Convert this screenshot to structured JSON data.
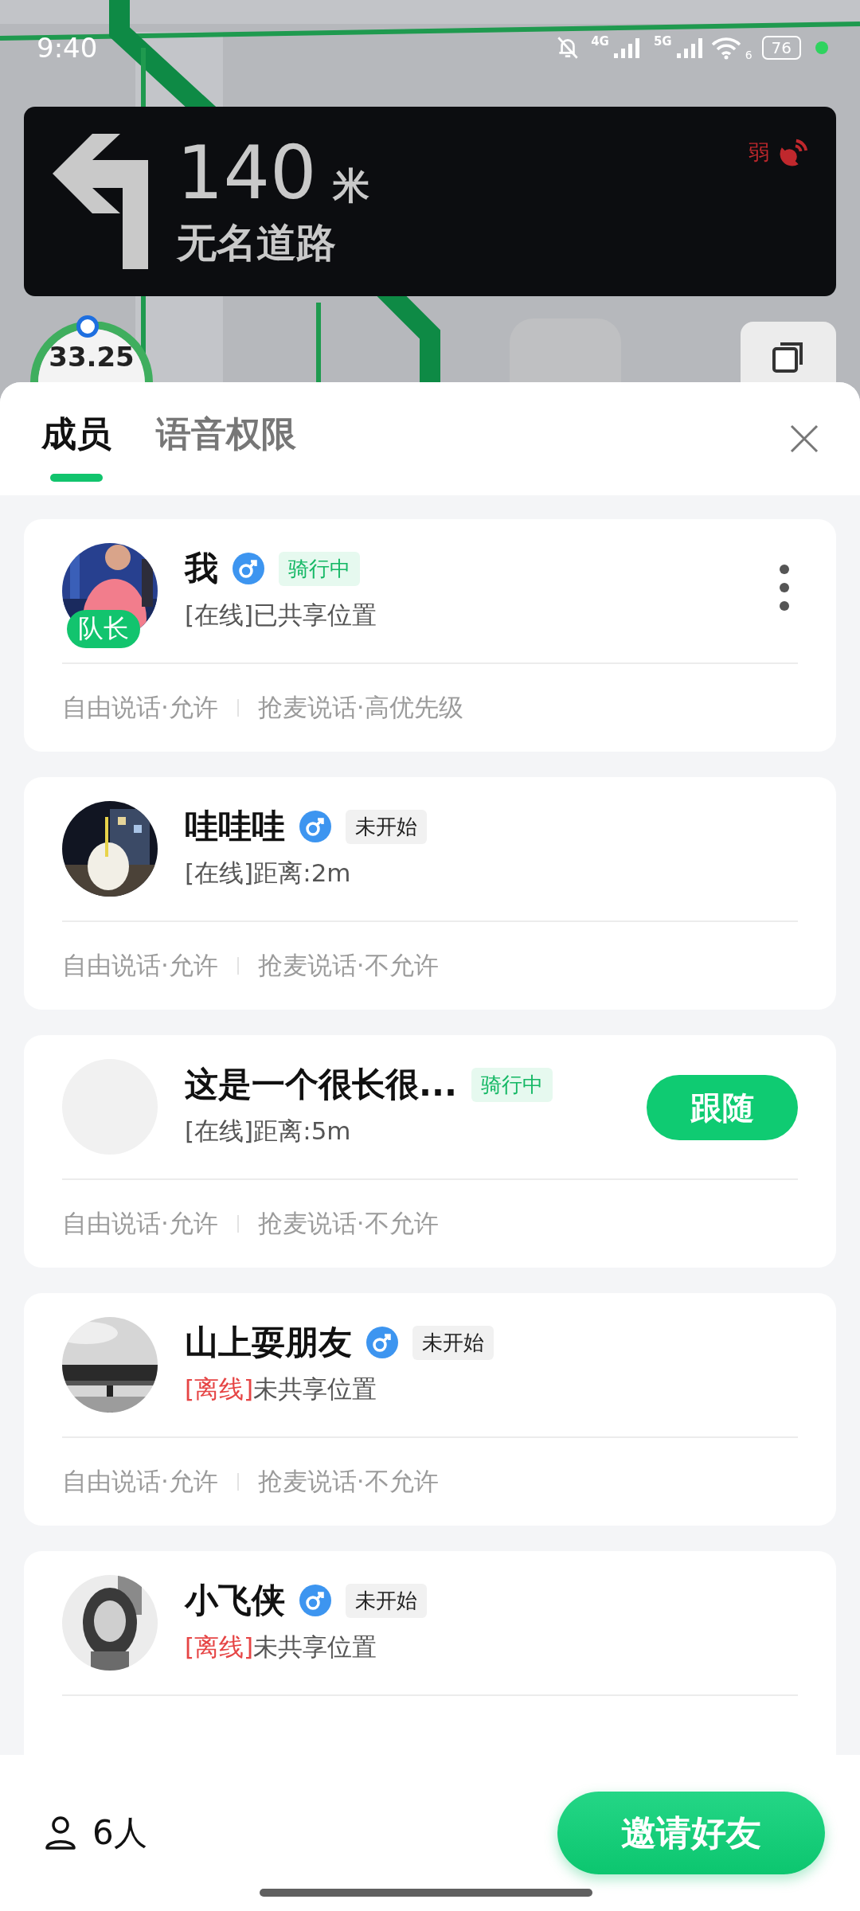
{
  "status_bar": {
    "time": "9:40",
    "sim1": "4G",
    "sim2": "5G",
    "wifi_badge": "6",
    "battery": "76"
  },
  "navigation": {
    "distance": "140",
    "unit": "米",
    "road": "无名道路",
    "signal": "弱"
  },
  "speed": {
    "value": "33.25"
  },
  "tabs": [
    {
      "label": "成员",
      "selected": true
    },
    {
      "label": "语音权限",
      "selected": false
    }
  ],
  "members": [
    {
      "name": "我",
      "badge": "队长",
      "male": true,
      "status": {
        "text": "骑行中",
        "kind": "riding"
      },
      "presence": {
        "text": "[在线]",
        "offline": false
      },
      "detail": "已共享位置",
      "action": {
        "kind": "menu"
      },
      "footer": [
        "自由说话·允许",
        "抢麦说话·高优先级"
      ]
    },
    {
      "name": "哇哇哇",
      "male": true,
      "status": {
        "text": "未开始",
        "kind": "idle"
      },
      "presence": {
        "text": "[在线]",
        "offline": false
      },
      "detail": "距离:2m",
      "footer": [
        "自由说话·允许",
        "抢麦说话·不允许"
      ]
    },
    {
      "name": "这是一个很长很...",
      "avatar": {
        "kind": "blank"
      },
      "status": {
        "text": "骑行中",
        "kind": "riding"
      },
      "presence": {
        "text": "[在线]",
        "offline": false
      },
      "detail": "距离:5m",
      "action": {
        "kind": "button",
        "label": "跟随"
      },
      "footer": [
        "自由说话·允许",
        "抢麦说话·不允许"
      ]
    },
    {
      "name": "山上耍朋友",
      "male": true,
      "status": {
        "text": "未开始",
        "kind": "idle"
      },
      "presence": {
        "text": "[离线]",
        "offline": true
      },
      "detail": "未共享位置",
      "footer": [
        "自由说话·允许",
        "抢麦说话·不允许"
      ]
    },
    {
      "name": "小飞侠",
      "male": true,
      "status": {
        "text": "未开始",
        "kind": "idle"
      },
      "presence": {
        "text": "[离线]",
        "offline": true
      },
      "detail": "未共享位置"
    }
  ],
  "footer": {
    "count": "6人",
    "invite_button": "邀请好友"
  }
}
